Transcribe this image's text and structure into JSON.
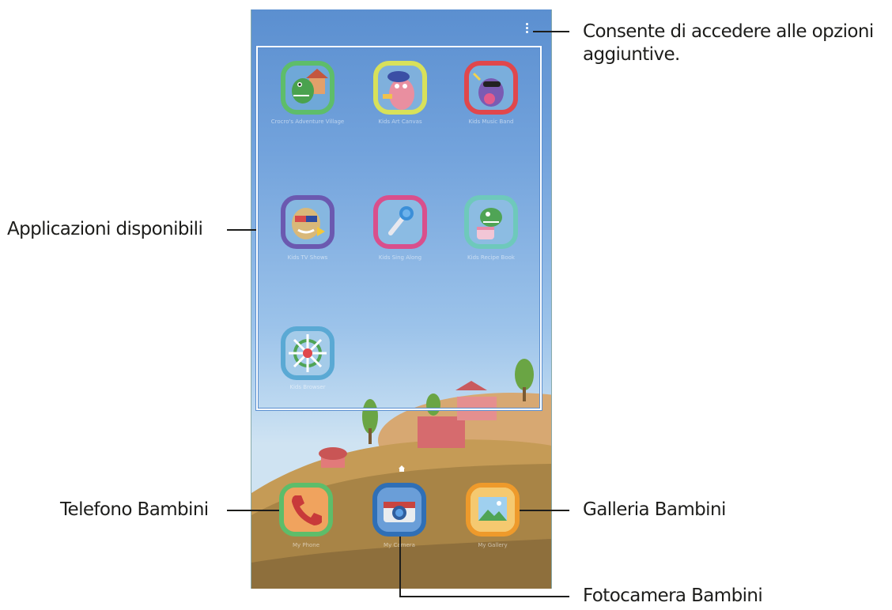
{
  "callouts": {
    "more_options": "Consente di accedere alle opzioni aggiuntive.",
    "available_apps": "Applicazioni disponibili",
    "kids_phone": "Telefono Bambini",
    "kids_gallery": "Galleria Bambini",
    "kids_camera": "Fotocamera Bambini"
  },
  "colors": {
    "sky_top": "#5b8fd0",
    "ground": "#b38b4b",
    "tile_green": "#5ebd6a",
    "tile_yellow": "#d8e15a",
    "tile_red": "#e0474c",
    "tile_purple": "#6b59b0",
    "tile_pink": "#d94f8c",
    "tile_teal": "#6ec9bb",
    "tile_blue": "#2f6fb6",
    "tile_orange": "#ee9a2b"
  },
  "apps": [
    {
      "icon": "dinosaur-house-icon",
      "caption": "Crocro's Adventure Village"
    },
    {
      "icon": "painter-creature-icon",
      "caption": "Kids Art Canvas"
    },
    {
      "icon": "music-monster-icon",
      "caption": "Kids Music Band"
    },
    {
      "icon": "popcorn-monster-icon",
      "caption": "Kids TV Shows"
    },
    {
      "icon": "microphone-icon",
      "caption": "Kids Sing Along"
    },
    {
      "icon": "dinosaur-cake-icon",
      "caption": "Kids Recipe Book"
    },
    {
      "icon": "compass-wheel-icon",
      "caption": "Kids Browser"
    }
  ],
  "dock": [
    {
      "icon": "phone-handset-icon",
      "caption": "My Phone"
    },
    {
      "icon": "camera-icon",
      "caption": "My Camera"
    },
    {
      "icon": "gallery-picture-icon",
      "caption": "My Gallery"
    }
  ]
}
